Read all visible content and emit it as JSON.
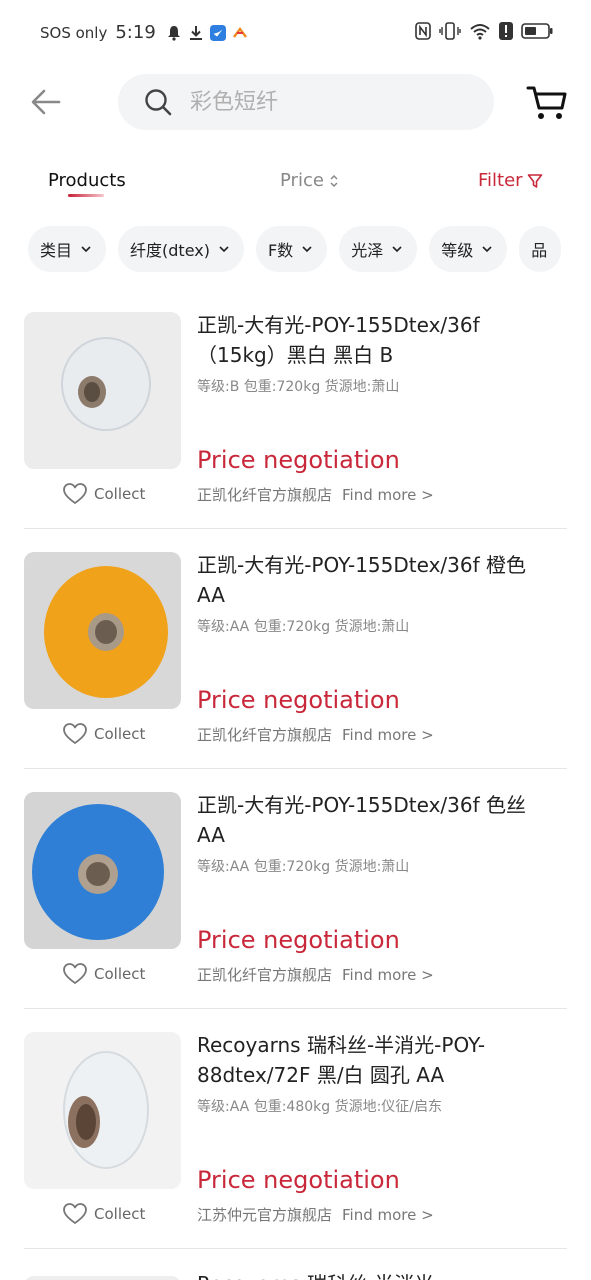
{
  "status_bar": {
    "carrier": "SOS only",
    "time": "5:19"
  },
  "search": {
    "placeholder": "彩色短纤"
  },
  "sort": {
    "products_label": "Products",
    "price_label": "Price",
    "filter_label": "Filter"
  },
  "filters": [
    "类目",
    "纤度(dtex)",
    "F数",
    "光泽",
    "等级",
    "品"
  ],
  "products": [
    {
      "title": "正凯-大有光-POY-155Dtex/36f（15kg）黑白 黑白  B",
      "specs": "等级:B   包重:720kg   货源地:萧山",
      "price": "Price negotiation",
      "store": "正凯化纤官方旗舰店",
      "more": "Find more >",
      "collect": "Collect",
      "color": "#e8ecef"
    },
    {
      "title": "正凯-大有光-POY-155Dtex/36f 橙色 AA",
      "specs": "等级:AA   包重:720kg   货源地:萧山",
      "price": "Price negotiation",
      "store": "正凯化纤官方旗舰店",
      "more": "Find more >",
      "collect": "Collect",
      "color": "#f0a21b"
    },
    {
      "title": "正凯-大有光-POY-155Dtex/36f 色丝 AA",
      "specs": "等级:AA   包重:720kg   货源地:萧山",
      "price": "Price negotiation",
      "store": "正凯化纤官方旗舰店",
      "more": "Find more >",
      "collect": "Collect",
      "color": "#2f7fd6"
    },
    {
      "title": "Recoyarns 瑞科丝-半消光-POY-88dtex/72F 黑/白 圆孔 AA",
      "specs": "等级:AA   包重:480kg   货源地:仪征/启东",
      "price": "Price negotiation",
      "store": "江苏仲元官方旗舰店",
      "more": "Find more >",
      "collect": "Collect",
      "color": "#eef1f4"
    }
  ],
  "peek_title": "Recoyarns 瑞科丝-半消光",
  "colors": {
    "accent": "#c8283a",
    "chip_bg": "#f3f4f6"
  }
}
